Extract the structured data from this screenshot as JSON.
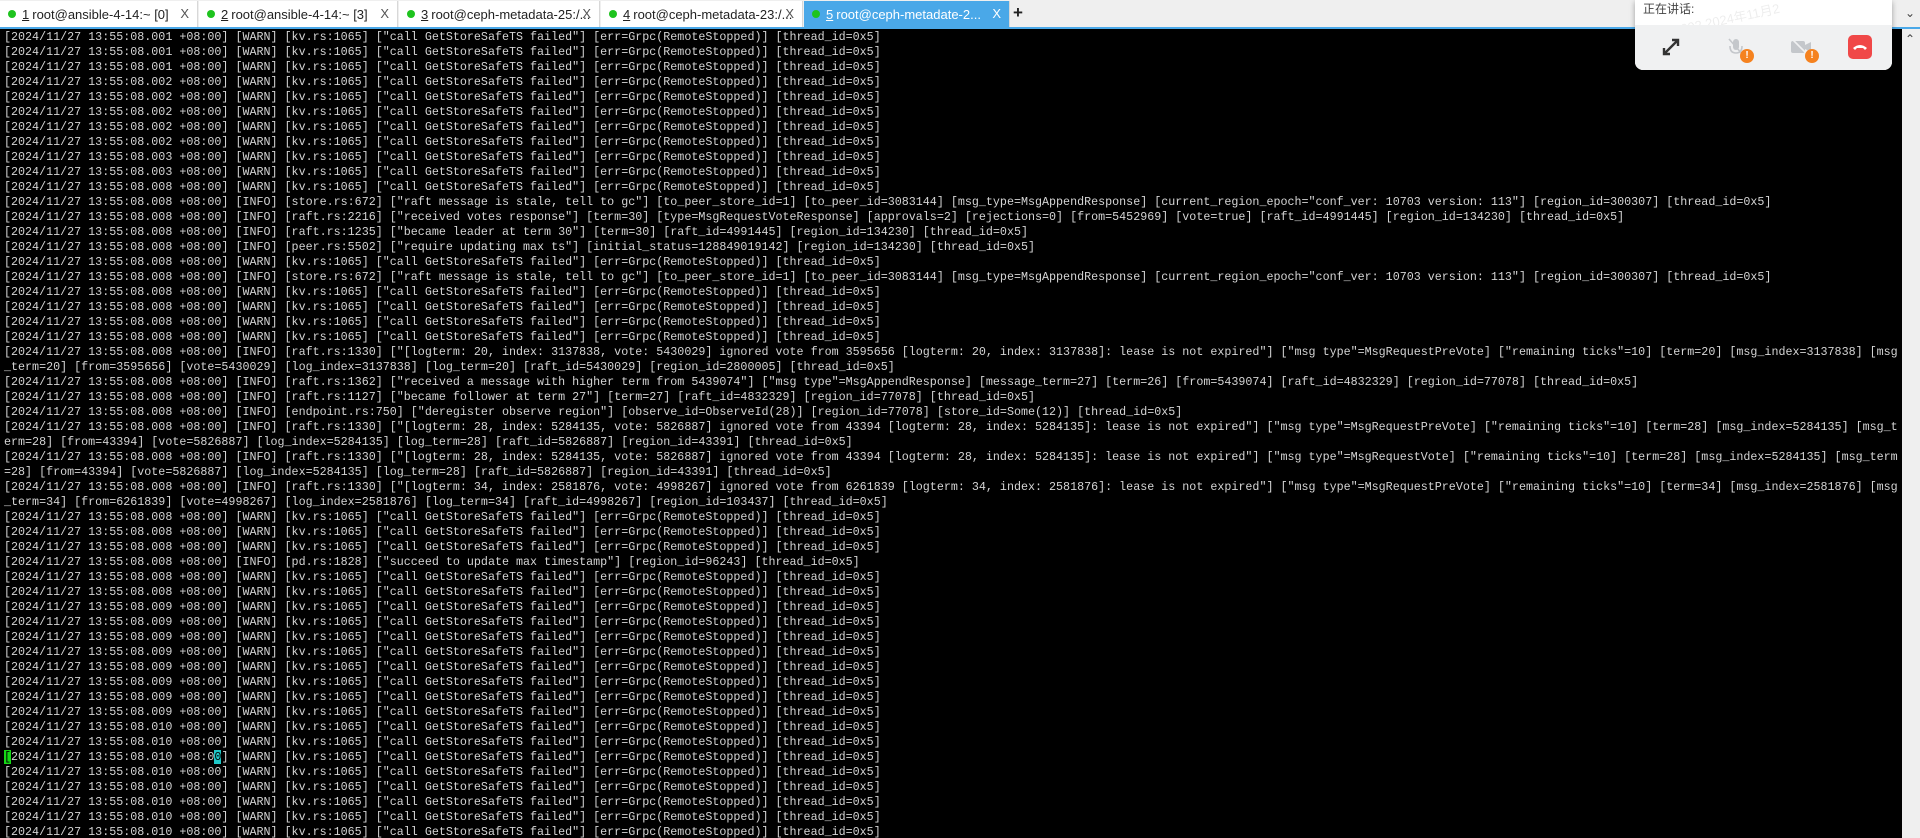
{
  "tabs": [
    {
      "num": "1",
      "label": " root@ansible-4-14:~ [0]",
      "active": false
    },
    {
      "num": "2",
      "label": " root@ansible-4-14:~ [3]",
      "active": false
    },
    {
      "num": "3",
      "label": " root@ceph-metadata-25:/...",
      "active": false
    },
    {
      "num": "4",
      "label": " root@ceph-metadata-23:/...",
      "active": false
    },
    {
      "num": "5",
      "label": " root@ceph-metadate-2...",
      "active": true
    }
  ],
  "tab_close": "X",
  "new_tab": "+",
  "meeting": {
    "speaking_label": "正在讲话:",
    "watermark": "王鹏 3602 2024年11月2",
    "badge": "!"
  },
  "colors": {
    "accent": "#4aa8e8",
    "status_dot": "#1ec31e",
    "hangup": "#f04848",
    "warning": "#f5821f"
  },
  "terminal": {
    "cursor_line": 48,
    "lines": [
      "[2024/11/27 13:55:08.001 +08:00] [WARN] [kv.rs:1065] [\"call GetStoreSafeTS failed\"] [err=Grpc(RemoteStopped)] [thread_id=0x5]",
      "[2024/11/27 13:55:08.001 +08:00] [WARN] [kv.rs:1065] [\"call GetStoreSafeTS failed\"] [err=Grpc(RemoteStopped)] [thread_id=0x5]",
      "[2024/11/27 13:55:08.001 +08:00] [WARN] [kv.rs:1065] [\"call GetStoreSafeTS failed\"] [err=Grpc(RemoteStopped)] [thread_id=0x5]",
      "[2024/11/27 13:55:08.002 +08:00] [WARN] [kv.rs:1065] [\"call GetStoreSafeTS failed\"] [err=Grpc(RemoteStopped)] [thread_id=0x5]",
      "[2024/11/27 13:55:08.002 +08:00] [WARN] [kv.rs:1065] [\"call GetStoreSafeTS failed\"] [err=Grpc(RemoteStopped)] [thread_id=0x5]",
      "[2024/11/27 13:55:08.002 +08:00] [WARN] [kv.rs:1065] [\"call GetStoreSafeTS failed\"] [err=Grpc(RemoteStopped)] [thread_id=0x5]",
      "[2024/11/27 13:55:08.002 +08:00] [WARN] [kv.rs:1065] [\"call GetStoreSafeTS failed\"] [err=Grpc(RemoteStopped)] [thread_id=0x5]",
      "[2024/11/27 13:55:08.002 +08:00] [WARN] [kv.rs:1065] [\"call GetStoreSafeTS failed\"] [err=Grpc(RemoteStopped)] [thread_id=0x5]",
      "[2024/11/27 13:55:08.003 +08:00] [WARN] [kv.rs:1065] [\"call GetStoreSafeTS failed\"] [err=Grpc(RemoteStopped)] [thread_id=0x5]",
      "[2024/11/27 13:55:08.003 +08:00] [WARN] [kv.rs:1065] [\"call GetStoreSafeTS failed\"] [err=Grpc(RemoteStopped)] [thread_id=0x5]",
      "[2024/11/27 13:55:08.008 +08:00] [WARN] [kv.rs:1065] [\"call GetStoreSafeTS failed\"] [err=Grpc(RemoteStopped)] [thread_id=0x5]",
      "[2024/11/27 13:55:08.008 +08:00] [INFO] [store.rs:672] [\"raft message is stale, tell to gc\"] [to_peer_store_id=1] [to_peer_id=3083144] [msg_type=MsgAppendResponse] [current_region_epoch=\"conf_ver: 10703 version: 113\"] [region_id=300307] [thread_id=0x5]",
      "[2024/11/27 13:55:08.008 +08:00] [INFO] [raft.rs:2216] [\"received votes response\"] [term=30] [type=MsgRequestVoteResponse] [approvals=2] [rejections=0] [from=5452969] [vote=true] [raft_id=4991445] [region_id=134230] [thread_id=0x5]",
      "[2024/11/27 13:55:08.008 +08:00] [INFO] [raft.rs:1235] [\"became leader at term 30\"] [term=30] [raft_id=4991445] [region_id=134230] [thread_id=0x5]",
      "[2024/11/27 13:55:08.008 +08:00] [INFO] [peer.rs:5502] [\"require updating max ts\"] [initial_status=128849019142] [region_id=134230] [thread_id=0x5]",
      "[2024/11/27 13:55:08.008 +08:00] [WARN] [kv.rs:1065] [\"call GetStoreSafeTS failed\"] [err=Grpc(RemoteStopped)] [thread_id=0x5]",
      "[2024/11/27 13:55:08.008 +08:00] [INFO] [store.rs:672] [\"raft message is stale, tell to gc\"] [to_peer_store_id=1] [to_peer_id=3083144] [msg_type=MsgAppendResponse] [current_region_epoch=\"conf_ver: 10703 version: 113\"] [region_id=300307] [thread_id=0x5]",
      "[2024/11/27 13:55:08.008 +08:00] [WARN] [kv.rs:1065] [\"call GetStoreSafeTS failed\"] [err=Grpc(RemoteStopped)] [thread_id=0x5]",
      "[2024/11/27 13:55:08.008 +08:00] [WARN] [kv.rs:1065] [\"call GetStoreSafeTS failed\"] [err=Grpc(RemoteStopped)] [thread_id=0x5]",
      "[2024/11/27 13:55:08.008 +08:00] [WARN] [kv.rs:1065] [\"call GetStoreSafeTS failed\"] [err=Grpc(RemoteStopped)] [thread_id=0x5]",
      "[2024/11/27 13:55:08.008 +08:00] [WARN] [kv.rs:1065] [\"call GetStoreSafeTS failed\"] [err=Grpc(RemoteStopped)] [thread_id=0x5]",
      "[2024/11/27 13:55:08.008 +08:00] [INFO] [raft.rs:1330] [\"[logterm: 20, index: 3137838, vote: 5430029] ignored vote from 3595656 [logterm: 20, index: 3137838]: lease is not expired\"] [\"msg type\"=MsgRequestPreVote] [\"remaining ticks\"=10] [term=20] [msg_index=3137838] [msg",
      "_term=20] [from=3595656] [vote=5430029] [log_index=3137838] [log_term=20] [raft_id=5430029] [region_id=2800005] [thread_id=0x5]",
      "[2024/11/27 13:55:08.008 +08:00] [INFO] [raft.rs:1362] [\"received a message with higher term from 5439074\"] [\"msg type\"=MsgAppendResponse] [message_term=27] [term=26] [from=5439074] [raft_id=4832329] [region_id=77078] [thread_id=0x5]",
      "[2024/11/27 13:55:08.008 +08:00] [INFO] [raft.rs:1127] [\"became follower at term 27\"] [term=27] [raft_id=4832329] [region_id=77078] [thread_id=0x5]",
      "[2024/11/27 13:55:08.008 +08:00] [INFO] [endpoint.rs:750] [\"deregister observe region\"] [observe_id=ObserveId(28)] [region_id=77078] [store_id=Some(12)] [thread_id=0x5]",
      "[2024/11/27 13:55:08.008 +08:00] [INFO] [raft.rs:1330] [\"[logterm: 28, index: 5284135, vote: 5826887] ignored vote from 43394 [logterm: 28, index: 5284135]: lease is not expired\"] [\"msg type\"=MsgRequestPreVote] [\"remaining ticks\"=10] [term=28] [msg_index=5284135] [msg_t",
      "erm=28] [from=43394] [vote=5826887] [log_index=5284135] [log_term=28] [raft_id=5826887] [region_id=43391] [thread_id=0x5]",
      "[2024/11/27 13:55:08.008 +08:00] [INFO] [raft.rs:1330] [\"[logterm: 28, index: 5284135, vote: 5826887] ignored vote from 43394 [logterm: 28, index: 5284135]: lease is not expired\"] [\"msg type\"=MsgRequestVote] [\"remaining ticks\"=10] [term=28] [msg_index=5284135] [msg_term",
      "=28] [from=43394] [vote=5826887] [log_index=5284135] [log_term=28] [raft_id=5826887] [region_id=43391] [thread_id=0x5]",
      "[2024/11/27 13:55:08.008 +08:00] [INFO] [raft.rs:1330] [\"[logterm: 34, index: 2581876, vote: 4998267] ignored vote from 6261839 [logterm: 34, index: 2581876]: lease is not expired\"] [\"msg type\"=MsgRequestPreVote] [\"remaining ticks\"=10] [term=34] [msg_index=2581876] [msg",
      "_term=34] [from=6261839] [vote=4998267] [log_index=2581876] [log_term=34] [raft_id=4998267] [region_id=103437] [thread_id=0x5]",
      "[2024/11/27 13:55:08.008 +08:00] [WARN] [kv.rs:1065] [\"call GetStoreSafeTS failed\"] [err=Grpc(RemoteStopped)] [thread_id=0x5]",
      "[2024/11/27 13:55:08.008 +08:00] [WARN] [kv.rs:1065] [\"call GetStoreSafeTS failed\"] [err=Grpc(RemoteStopped)] [thread_id=0x5]",
      "[2024/11/27 13:55:08.008 +08:00] [WARN] [kv.rs:1065] [\"call GetStoreSafeTS failed\"] [err=Grpc(RemoteStopped)] [thread_id=0x5]",
      "[2024/11/27 13:55:08.008 +08:00] [INFO] [pd.rs:1828] [\"succeed to update max timestamp\"] [region_id=96243] [thread_id=0x5]",
      "[2024/11/27 13:55:08.008 +08:00] [WARN] [kv.rs:1065] [\"call GetStoreSafeTS failed\"] [err=Grpc(RemoteStopped)] [thread_id=0x5]",
      "[2024/11/27 13:55:08.008 +08:00] [WARN] [kv.rs:1065] [\"call GetStoreSafeTS failed\"] [err=Grpc(RemoteStopped)] [thread_id=0x5]",
      "[2024/11/27 13:55:08.009 +08:00] [WARN] [kv.rs:1065] [\"call GetStoreSafeTS failed\"] [err=Grpc(RemoteStopped)] [thread_id=0x5]",
      "[2024/11/27 13:55:08.009 +08:00] [WARN] [kv.rs:1065] [\"call GetStoreSafeTS failed\"] [err=Grpc(RemoteStopped)] [thread_id=0x5]",
      "[2024/11/27 13:55:08.009 +08:00] [WARN] [kv.rs:1065] [\"call GetStoreSafeTS failed\"] [err=Grpc(RemoteStopped)] [thread_id=0x5]",
      "[2024/11/27 13:55:08.009 +08:00] [WARN] [kv.rs:1065] [\"call GetStoreSafeTS failed\"] [err=Grpc(RemoteStopped)] [thread_id=0x5]",
      "[2024/11/27 13:55:08.009 +08:00] [WARN] [kv.rs:1065] [\"call GetStoreSafeTS failed\"] [err=Grpc(RemoteStopped)] [thread_id=0x5]",
      "[2024/11/27 13:55:08.009 +08:00] [WARN] [kv.rs:1065] [\"call GetStoreSafeTS failed\"] [err=Grpc(RemoteStopped)] [thread_id=0x5]",
      "[2024/11/27 13:55:08.009 +08:00] [WARN] [kv.rs:1065] [\"call GetStoreSafeTS failed\"] [err=Grpc(RemoteStopped)] [thread_id=0x5]",
      "[2024/11/27 13:55:08.009 +08:00] [WARN] [kv.rs:1065] [\"call GetStoreSafeTS failed\"] [err=Grpc(RemoteStopped)] [thread_id=0x5]",
      "[2024/11/27 13:55:08.010 +08:00] [WARN] [kv.rs:1065] [\"call GetStoreSafeTS failed\"] [err=Grpc(RemoteStopped)] [thread_id=0x5]",
      "[2024/11/27 13:55:08.010 +08:00] [WARN] [kv.rs:1065] [\"call GetStoreSafeTS failed\"] [err=Grpc(RemoteStopped)] [thread_id=0x5]",
      "[2024/11/27 13:55:08.010 +08:00] [WARN] [kv.rs:1065] [\"call GetStoreSafeTS failed\"] [err=Grpc(RemoteStopped)] [thread_id=0x5]",
      "[2024/11/27 13:55:08.010 +08:00] [WARN] [kv.rs:1065] [\"call GetStoreSafeTS failed\"] [err=Grpc(RemoteStopped)] [thread_id=0x5]",
      "[2024/11/27 13:55:08.010 +08:00] [WARN] [kv.rs:1065] [\"call GetStoreSafeTS failed\"] [err=Grpc(RemoteStopped)] [thread_id=0x5]",
      "[2024/11/27 13:55:08.010 +08:00] [WARN] [kv.rs:1065] [\"call GetStoreSafeTS failed\"] [err=Grpc(RemoteStopped)] [thread_id=0x5]",
      "[2024/11/27 13:55:08.010 +08:00] [WARN] [kv.rs:1065] [\"call GetStoreSafeTS failed\"] [err=Grpc(RemoteStopped)] [thread_id=0x5]",
      "[2024/11/27 13:55:08.010 +08:00] [WARN] [kv.rs:1065] [\"call GetStoreSafeTS failed\"] [err=Grpc(RemoteStopped)] [thread_id=0x5]"
    ]
  }
}
